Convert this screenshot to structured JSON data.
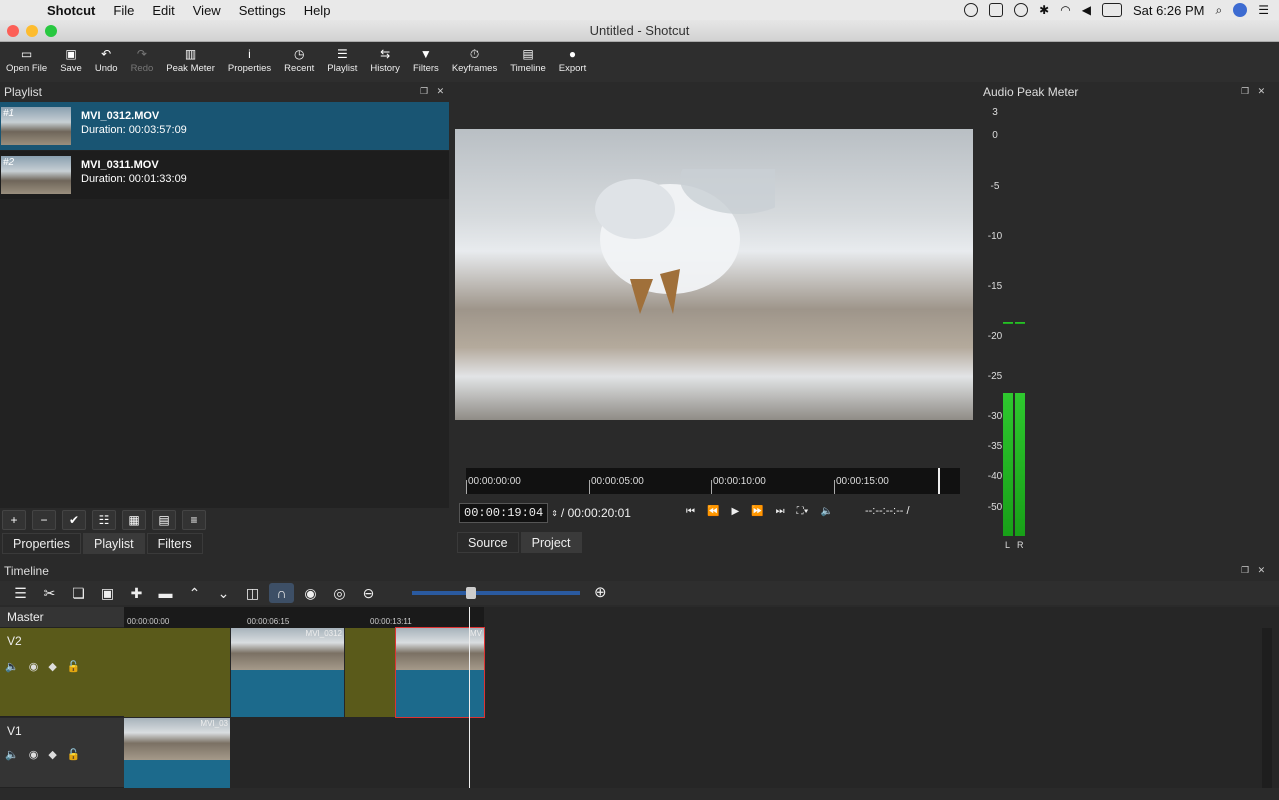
{
  "menubar": {
    "apple": "",
    "items": [
      "Shotcut",
      "File",
      "Edit",
      "View",
      "Settings",
      "Help"
    ],
    "clock": "Sat 6:26 PM"
  },
  "window": {
    "title": "Untitled - Shotcut"
  },
  "toolbar": {
    "buttons": [
      {
        "label": "Open File",
        "icon": "folder-icon",
        "glyph": "▭"
      },
      {
        "label": "Save",
        "icon": "save-icon",
        "glyph": "▣"
      },
      {
        "label": "Undo",
        "icon": "undo-icon",
        "glyph": "↶"
      },
      {
        "label": "Redo",
        "icon": "redo-icon",
        "glyph": "↷"
      },
      {
        "label": "Peak Meter",
        "icon": "meter-icon",
        "glyph": "▥"
      },
      {
        "label": "Properties",
        "icon": "info-icon",
        "glyph": "i"
      },
      {
        "label": "Recent",
        "icon": "clock-icon",
        "glyph": "◷"
      },
      {
        "label": "Playlist",
        "icon": "list-icon",
        "glyph": "☰"
      },
      {
        "label": "History",
        "icon": "history-icon",
        "glyph": "⇆"
      },
      {
        "label": "Filters",
        "icon": "filter-icon",
        "glyph": "▼"
      },
      {
        "label": "Keyframes",
        "icon": "stopwatch-icon",
        "glyph": "⏱"
      },
      {
        "label": "Timeline",
        "icon": "timeline-icon",
        "glyph": "▤"
      },
      {
        "label": "Export",
        "icon": "export-icon",
        "glyph": "●"
      }
    ]
  },
  "playlist": {
    "title": "Playlist",
    "items": [
      {
        "num": "#1",
        "name": "MVI_0312.MOV",
        "duration": "Duration: 00:03:57:09"
      },
      {
        "num": "#2",
        "name": "MVI_0311.MOV",
        "duration": "Duration: 00:01:33:09"
      }
    ],
    "tools": [
      "+",
      "−",
      "✔",
      "☷",
      "▦",
      "▤",
      "≡"
    ],
    "tabs": [
      "Properties",
      "Playlist",
      "Filters"
    ]
  },
  "player": {
    "ruler": [
      "00:00:00:00",
      "00:00:05:00",
      "00:00:10:00",
      "00:00:15:00"
    ],
    "timecode": "00:00:19:04",
    "duration": "/ 00:00:20:01",
    "in_out": "--:--:--:-- /",
    "tabs": [
      "Source",
      "Project"
    ]
  },
  "audio_meter": {
    "title": "Audio Peak Meter",
    "scale": [
      "3",
      "0",
      "-5",
      "-10",
      "-15",
      "-20",
      "-25",
      "-30",
      "-35",
      "-40",
      "-50"
    ],
    "left_label": "L",
    "right_label": "R"
  },
  "timeline": {
    "title": "Timeline",
    "ruler": [
      "00:00:00:00",
      "00:00:06:15",
      "00:00:13:11"
    ],
    "tracks": [
      {
        "name": "Master"
      },
      {
        "name": "V2"
      },
      {
        "name": "V1"
      }
    ],
    "clips": {
      "v2a": "MVI_0312",
      "v2b": "MV",
      "v1a": "MVI_03"
    }
  }
}
